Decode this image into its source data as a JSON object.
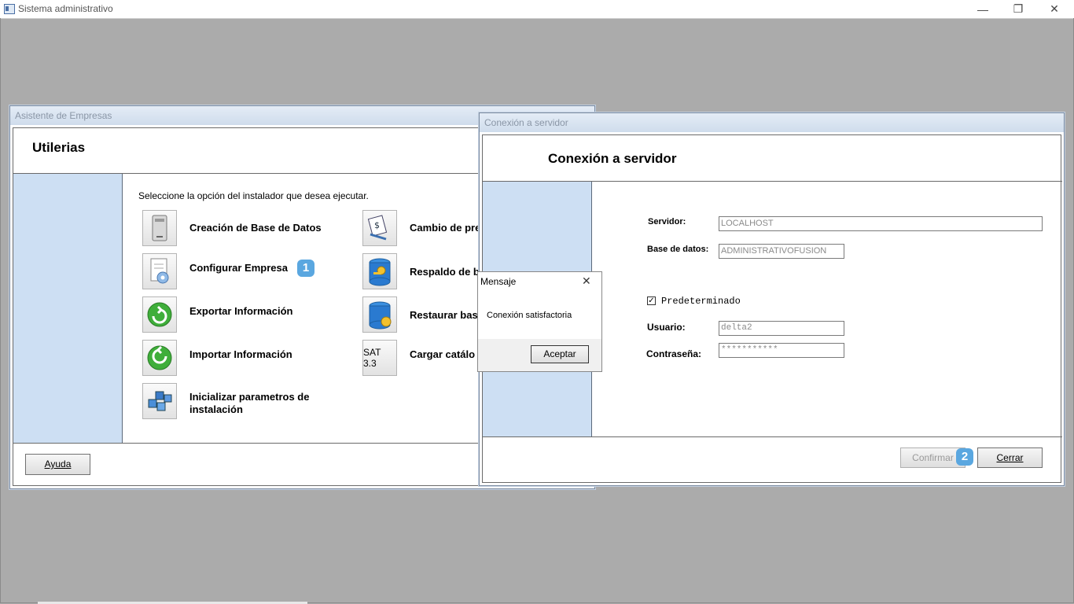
{
  "main_window": {
    "title": "Sistema administrativo",
    "minimize_glyph": "—",
    "restore_glyph": "❐",
    "close_glyph": "✕"
  },
  "asistente": {
    "window_title": "Asistente de Empresas",
    "header": "Utilerias",
    "instruction": "Seleccione la opción del instalador que desea ejecutar.",
    "options_left": [
      {
        "label": "Creación de Base de Datos",
        "icon": "server-icon"
      },
      {
        "label": "Configurar Empresa",
        "icon": "document-gear-icon"
      },
      {
        "label": "Exportar Información",
        "icon": "export-arrow-icon"
      },
      {
        "label": "Importar Información",
        "icon": "import-arrow-icon"
      },
      {
        "label": "Inicializar parametros de instalación",
        "icon": "cubes-icon"
      }
    ],
    "options_right": [
      {
        "label": "Cambio de pre",
        "icon": "price-change-icon"
      },
      {
        "label": "Respaldo de b",
        "icon": "database-key-icon"
      },
      {
        "label": "Restaurar bas",
        "icon": "database-gear-icon"
      },
      {
        "label": "Cargar catálo",
        "icon_text": "SAT 3.3"
      }
    ],
    "badge_1": "1",
    "help_button": "Ayuda"
  },
  "conexion": {
    "window_title": "Conexión a servidor",
    "header": "Conexión a servidor",
    "servidor_label": "Servidor:",
    "servidor_value": "LOCALHOST",
    "base_label": "Base de datos:",
    "base_value": "ADMINISTRATIVOFUSION",
    "predeterminado_label": "Predeterminado",
    "predeterminado_checked": true,
    "check_glyph": "✓",
    "usuario_label": "Usuario:",
    "usuario_value": "delta2",
    "contrasena_label": "Contraseña:",
    "contrasena_value": "***********",
    "confirm_button": "Confirmar",
    "close_button": "Cerrar",
    "badge_2": "2"
  },
  "mensaje": {
    "title": "Mensaje",
    "text": "Conexión satisfactoria",
    "ok_button": "Aceptar",
    "close_glyph": "✕"
  },
  "colors": {
    "desktop": "#ababab",
    "side_panel": "#cddff3",
    "badge": "#5aa7e0"
  }
}
